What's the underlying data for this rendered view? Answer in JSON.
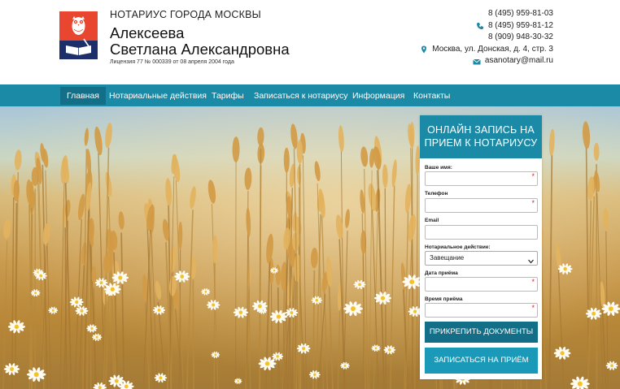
{
  "header": {
    "kicker": "НОТАРИУС ГОРОДА МОСКВЫ",
    "name_line1": "Алексеева",
    "name_line2": "Светлана Александровна",
    "license": "Лицензия 77 № 000339 от 08 апреля 2004 года"
  },
  "contacts": {
    "phone1": "8 (495) 959-81-03",
    "phone2": "8 (495) 959-81-12",
    "phone3": "8 (909) 948-30-32",
    "address": "Москва, ул. Донская, д. 4, стр. 3",
    "email": "asanotary@mail.ru"
  },
  "nav": {
    "items": [
      {
        "label": "Главная",
        "active": true
      },
      {
        "label": "Нотариальные действия"
      },
      {
        "label": "Тарифы"
      },
      {
        "label": "Записаться к нотариусу"
      },
      {
        "label": "Информация"
      },
      {
        "label": "Контакты"
      }
    ]
  },
  "form": {
    "title_line1": "ОНЛАЙН ЗАПИСЬ НА",
    "title_line2": "ПРИЕМ К НОТАРИУСУ",
    "name_label": "Ваше имя:",
    "phone_label": "Телефон",
    "email_label": "Email",
    "action_label": "Нотариальное действие:",
    "action_value": "Завещание",
    "date_label": "Дата приёма",
    "time_label": "Время приёма",
    "required_mark": "*",
    "attach_button": "ПРИКРЕПИТЬ ДОКУМЕНТЫ",
    "submit_button": "ЗАПИСАТЬСЯ НА ПРИЁМ"
  },
  "colors": {
    "accent": "#1a8aa6",
    "accent_dark": "#136f88",
    "logo_red": "#e8462f",
    "logo_navy": "#1d2f6b"
  }
}
